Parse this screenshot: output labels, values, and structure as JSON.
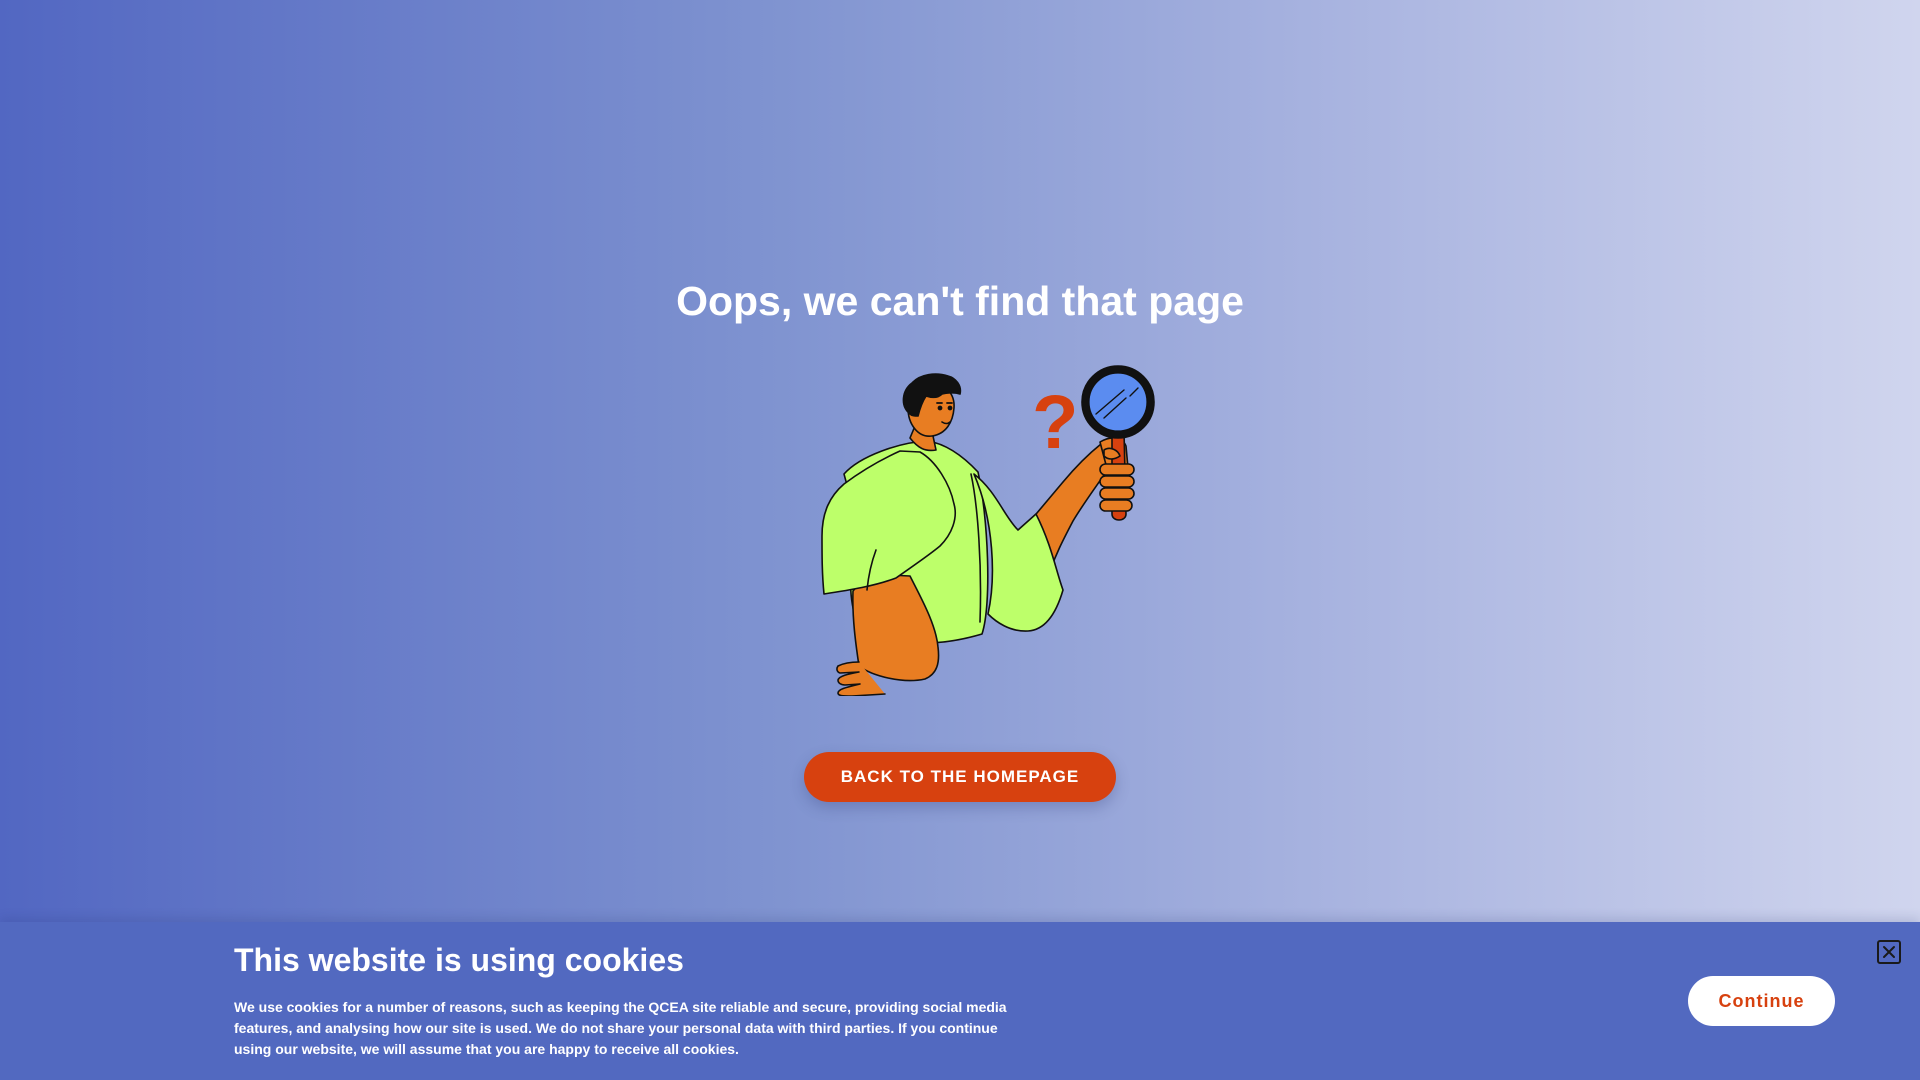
{
  "main": {
    "title": "Oops, we can't find that page",
    "home_button_label": "BACK TO THE HOMEPAGE",
    "illustration_icon": "person-with-magnifying-glass-icon"
  },
  "cookie_banner": {
    "title": "This website is using cookies",
    "text": "We use cookies for a number of reasons, such as keeping the QCEA site reliable and secure, providing social media features, and analysing how our site is used. We do not share your personal data with third parties. If you continue using our website, we will assume that you are happy to receive all cookies.",
    "continue_label": "Continue",
    "close_icon": "close-icon"
  },
  "colors": {
    "accent": "#d7410f",
    "banner_bg": "#5269c0",
    "shirt": "#bdff6a",
    "skin": "#e87d22",
    "lens": "#5b8cf0"
  }
}
